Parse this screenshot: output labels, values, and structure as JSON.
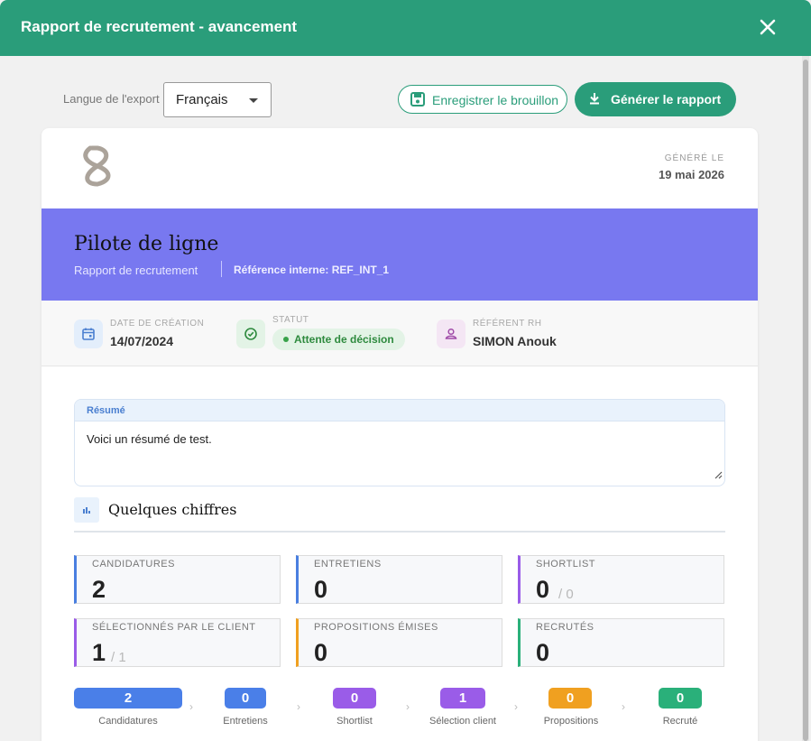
{
  "window": {
    "title": "Rapport de recrutement - avancement"
  },
  "toolbar": {
    "lang_label": "Langue de l'export",
    "lang_value": "Français",
    "draft_button": "Enregistrer le brouillon",
    "generate_button": "Générer le rapport"
  },
  "report": {
    "generated_label": "GÉNÉRÉ LE",
    "generated_date": "19 mai 2026",
    "title": "Pilote de ligne",
    "subtitle": "Rapport de recrutement",
    "reference": "Référence interne: REF_INT_1",
    "meta": {
      "creation_label": "DATE DE CRÉATION",
      "creation_value": "14/07/2024",
      "status_label": "STATUT",
      "status_value": "Attente de décision",
      "hr_label": "RÉFÉRENT RH",
      "hr_value": "SIMON Anouk"
    },
    "summary": {
      "label": "Résumé",
      "text": "Voici un résumé de test."
    },
    "figures_title": "Quelques chiffres",
    "stats": [
      {
        "label": "CANDIDATURES",
        "value": "2",
        "total": "",
        "color": "#4a7fe0"
      },
      {
        "label": "ENTRETIENS",
        "value": "0",
        "total": "",
        "color": "#4a7fe0"
      },
      {
        "label": "SHORTLIST",
        "value": "0",
        "total": "/ 0",
        "color": "#9a5ce8"
      },
      {
        "label": "SÉLECTIONNÉS PAR LE CLIENT",
        "value": "1",
        "total": "/ 1",
        "color": "#9a5ce8"
      },
      {
        "label": "PROPOSITIONS ÉMISES",
        "value": "0",
        "total": "",
        "color": "#f0a020"
      },
      {
        "label": "RECRUTÉS",
        "value": "0",
        "total": "",
        "color": "#2ab07a"
      }
    ],
    "funnel": [
      {
        "value": "2",
        "label": "Candidatures",
        "color": "#4a7fe8"
      },
      {
        "value": "0",
        "label": "Entretiens",
        "color": "#4a7fe8"
      },
      {
        "value": "0",
        "label": "Shortlist",
        "color": "#9a5ce8"
      },
      {
        "value": "1",
        "label": "Sélection client",
        "color": "#9a5ce8"
      },
      {
        "value": "0",
        "label": "Propositions",
        "color": "#f0a020"
      },
      {
        "value": "0",
        "label": "Recruté",
        "color": "#2ab07a"
      }
    ]
  }
}
